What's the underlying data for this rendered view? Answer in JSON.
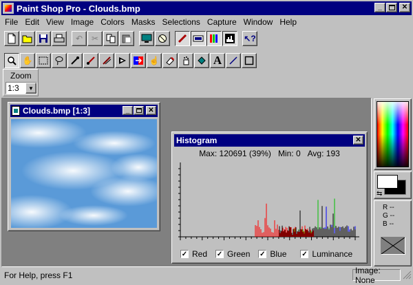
{
  "window": {
    "title": "Paint Shop Pro - Clouds.bmp"
  },
  "menu": [
    "File",
    "Edit",
    "View",
    "Image",
    "Colors",
    "Masks",
    "Selections",
    "Capture",
    "Window",
    "Help"
  ],
  "zoom": {
    "label": "Zoom",
    "value": "1:3"
  },
  "image_window": {
    "title": "Clouds.bmp [1:3]"
  },
  "histogram": {
    "title": "Histogram",
    "max": "Max: 120691 (39%)",
    "min": "Min: 0",
    "avg": "Avg: 193",
    "channels": [
      {
        "label": "Red",
        "checked": true,
        "color": "#ff0000"
      },
      {
        "label": "Green",
        "checked": true,
        "color": "#00c000"
      },
      {
        "label": "Blue",
        "checked": true,
        "color": "#0000ff"
      },
      {
        "label": "Luminance",
        "checked": true,
        "color": "#000000"
      }
    ]
  },
  "palette": {
    "r": "R --",
    "g": "G --",
    "b": "B --"
  },
  "status": {
    "help": "For Help, press F1",
    "image": "Image: None"
  }
}
